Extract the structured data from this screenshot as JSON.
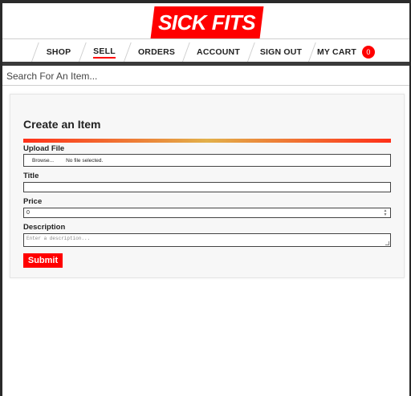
{
  "brand": {
    "logo_text": "SICK FITS",
    "accent": "#ff0000"
  },
  "nav": {
    "items": [
      {
        "label": "SHOP"
      },
      {
        "label": "SELL"
      },
      {
        "label": "ORDERS"
      },
      {
        "label": "ACCOUNT"
      },
      {
        "label": "SIGN OUT"
      },
      {
        "label": "MY CART"
      }
    ],
    "cart_count": "0",
    "active": "SELL"
  },
  "search": {
    "placeholder": "Search For An Item..."
  },
  "form": {
    "title": "Create an Item",
    "upload_label": "Upload File",
    "browse_label": "Browse...",
    "no_file_text": "No file selected.",
    "title_label": "Title",
    "title_value": "",
    "price_label": "Price",
    "price_value": "0",
    "description_label": "Description",
    "description_placeholder": "Enter a description...",
    "submit_label": "Submit"
  }
}
